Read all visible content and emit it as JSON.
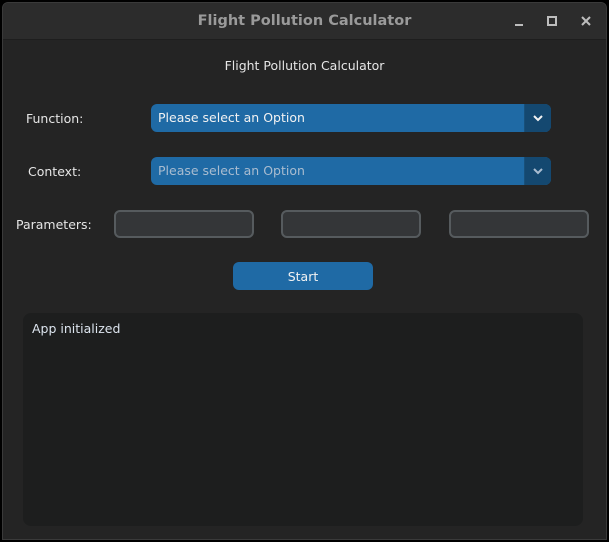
{
  "window": {
    "title": "Flight Pollution Calculator"
  },
  "main": {
    "heading": "Flight Pollution Calculator",
    "function": {
      "label": "Function:",
      "selected": "Please select an Option"
    },
    "context": {
      "label": "Context:",
      "selected": "Please select an Option"
    },
    "parameters": {
      "label": "Parameters:",
      "fields": [
        {
          "value": ""
        },
        {
          "value": ""
        },
        {
          "value": ""
        }
      ]
    },
    "start_label": "Start",
    "log_text": "App initialized"
  },
  "colors": {
    "accent": "#1f6aa5",
    "accent_dark": "#144870",
    "background": "#242424",
    "field_bg": "#343638",
    "log_bg": "#1d1e1e"
  },
  "icons": {
    "minimize": "minimize-icon",
    "maximize": "maximize-icon",
    "close": "close-icon",
    "dropdown": "chevron-down-icon"
  }
}
